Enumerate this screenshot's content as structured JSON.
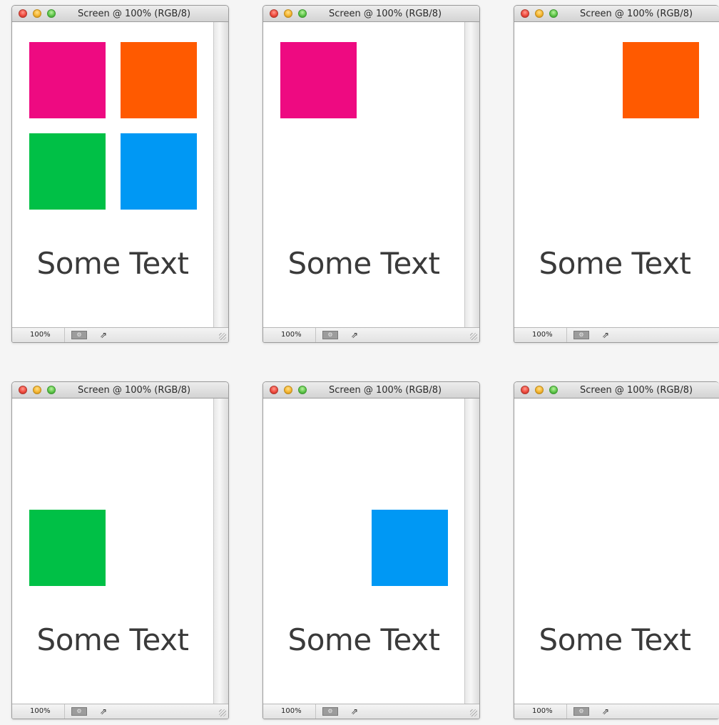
{
  "window_title": "Screen @ 100% (RGB/8)",
  "zoom": "100%",
  "canvas_text": "Some Text",
  "colors": {
    "pink": "#ee0a81",
    "orange": "#ff5a00",
    "green": "#00c046",
    "blue": "#0098f4"
  },
  "windows": [
    {
      "squares_visible": [
        "pink",
        "orange",
        "green",
        "blue"
      ]
    },
    {
      "squares_visible": [
        "pink"
      ]
    },
    {
      "squares_visible": [
        "orange"
      ]
    },
    {
      "squares_visible": [
        "green"
      ]
    },
    {
      "squares_visible": [
        "blue"
      ]
    },
    {
      "squares_visible": []
    }
  ]
}
